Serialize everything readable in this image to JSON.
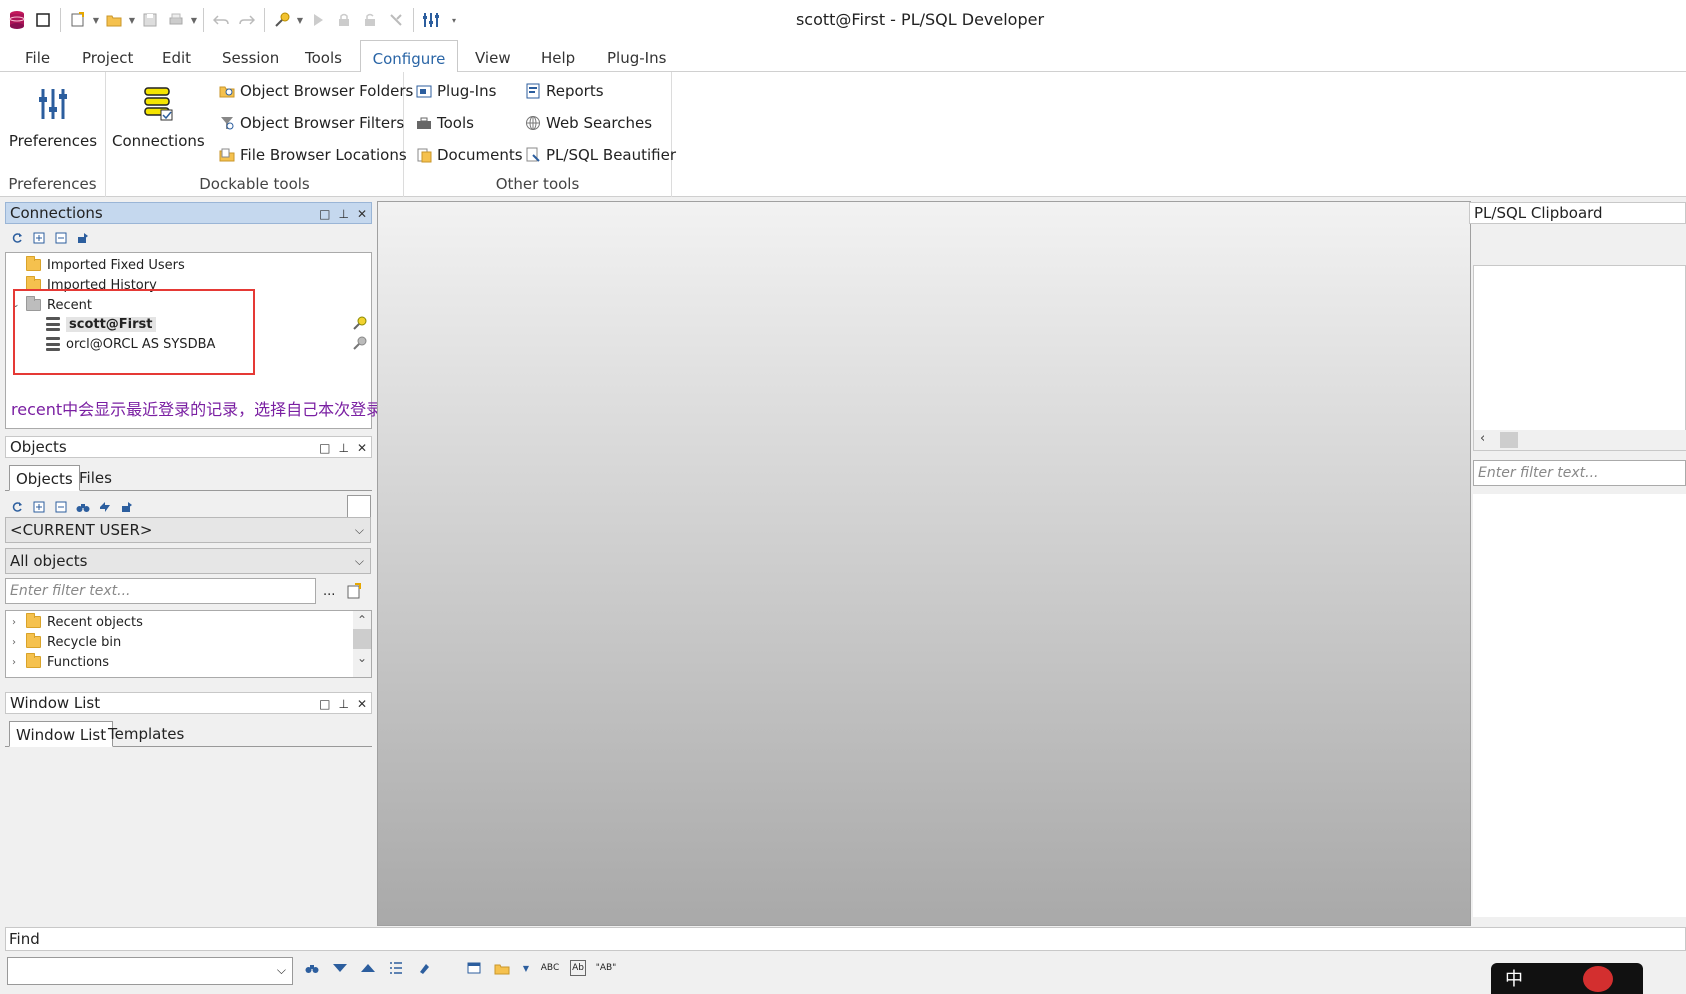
{
  "window": {
    "title": "scott@First - PL/SQL Developer"
  },
  "menu": {
    "tabs": [
      "File",
      "Project",
      "Edit",
      "Session",
      "Tools",
      "Configure",
      "View",
      "Help",
      "Plug-Ins"
    ],
    "active": "Configure"
  },
  "ribbon": {
    "groups": {
      "preferences": {
        "label": "Preferences",
        "button": "Preferences"
      },
      "dockable": {
        "label": "Dockable tools",
        "connections": "Connections",
        "object_browser_folders": "Object Browser Folders",
        "object_browser_filters": "Object Browser Filters",
        "file_browser_locations": "File Browser Locations"
      },
      "other": {
        "label": "Other tools",
        "plugins": "Plug-Ins",
        "tools": "Tools",
        "documents": "Documents",
        "reports": "Reports",
        "web_searches": "Web Searches",
        "beautifier": "PL/SQL Beautifier"
      }
    }
  },
  "connections": {
    "title": "Connections",
    "items": [
      "Imported Fixed Users",
      "Imported History",
      "Recent",
      "scott@First",
      "orcl@ORCL AS SYSDBA"
    ]
  },
  "annotation": "recent中会显示最近登录的记录，选择自己本次登录的信息，右击-->new就可以新建表等",
  "objects": {
    "title": "Objects",
    "tabs": [
      "Objects",
      "Files"
    ],
    "user_combo": "<CURRENT USER>",
    "type_combo": "All objects",
    "filter_placeholder": "Enter filter text...",
    "dots": "...",
    "tree": [
      "Recent objects",
      "Recycle bin",
      "Functions"
    ]
  },
  "window_list": {
    "title": "Window List",
    "tabs": [
      "Window List",
      "Templates"
    ]
  },
  "clipboard": {
    "title": "PL/SQL Clipboard",
    "filter_placeholder": "Enter filter text..."
  },
  "find": {
    "title": "Find"
  },
  "ime": {
    "label": "中"
  },
  "colors": {
    "accent": "#2a65a6",
    "active_panel": "#c5d8ee",
    "annotation_box": "#e53935",
    "annotation_text": "#7a1fa2"
  }
}
